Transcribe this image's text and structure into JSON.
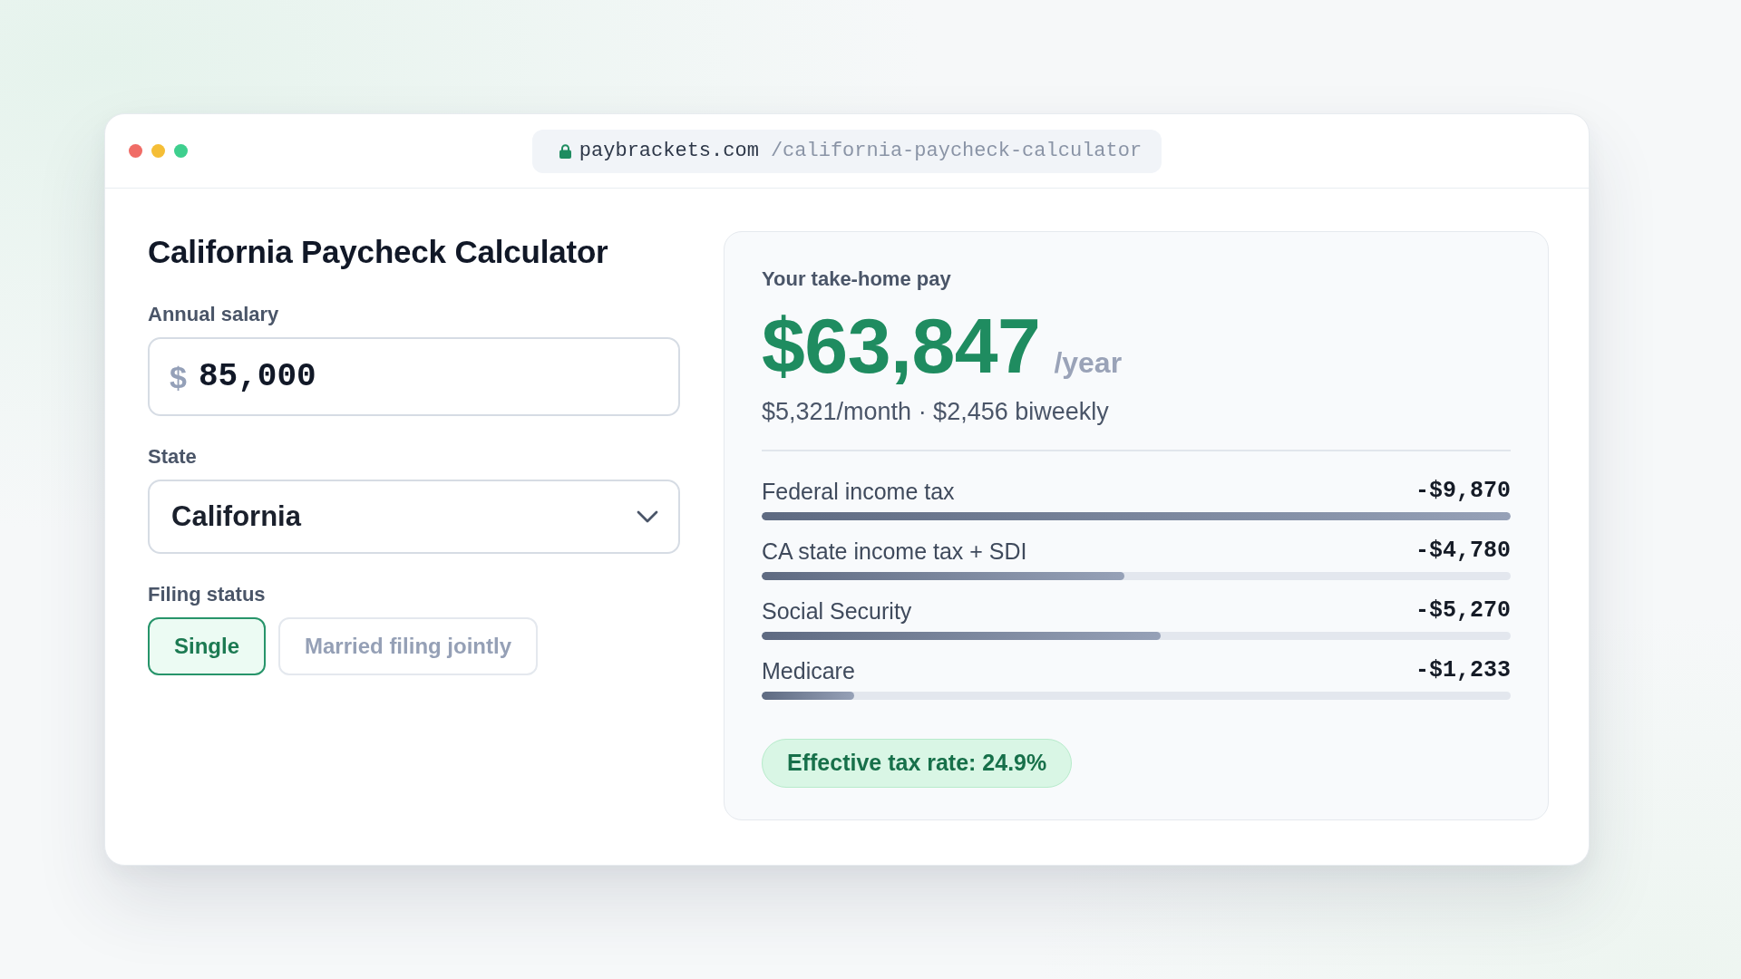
{
  "browser": {
    "url_domain": "paybrackets.com",
    "url_path": "/california-paycheck-calculator"
  },
  "calculator": {
    "title": "California Paycheck Calculator",
    "salary": {
      "label": "Annual salary",
      "prefix": "$",
      "value": "85,000"
    },
    "state": {
      "label": "State",
      "value": "California"
    },
    "filing_status": {
      "label": "Filing status",
      "options": [
        {
          "label": "Single",
          "selected": true
        },
        {
          "label": "Married filing jointly",
          "selected": false
        }
      ]
    }
  },
  "results": {
    "heading": "Your take-home pay",
    "amount": "$63,847",
    "period": "/year",
    "breakdown": "$5,321/month · $2,456 biweekly",
    "deductions": [
      {
        "name": "Federal income tax",
        "amount": "-$9,870",
        "level": 1.0
      },
      {
        "name": "CA state income tax + SDI",
        "amount": "-$4,780",
        "level": 0.484
      },
      {
        "name": "Social Security",
        "amount": "-$5,270",
        "level": 0.533
      },
      {
        "name": "Medicare",
        "amount": "-$1,233",
        "level": 0.124
      }
    ],
    "effective_rate": "Effective tax rate: 24.9%"
  }
}
